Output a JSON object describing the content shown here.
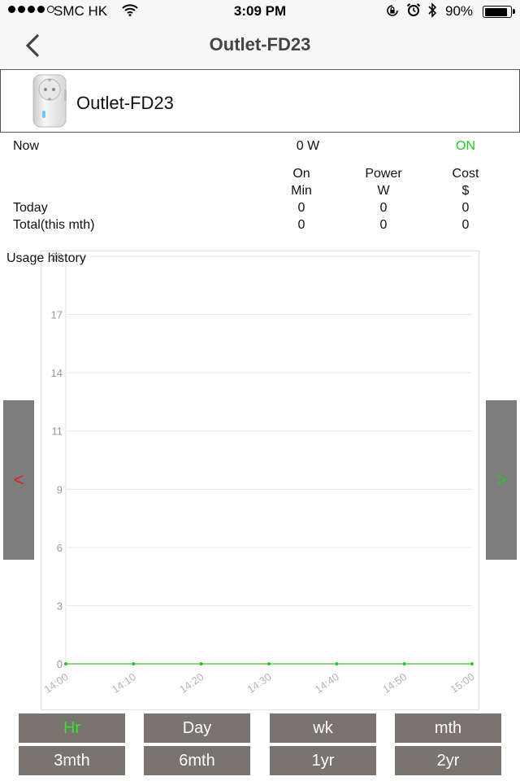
{
  "status_bar": {
    "carrier": "SMC HK",
    "time": "3:09 PM",
    "battery": "90%",
    "battery_level": 0.9,
    "signal_bars": 4,
    "icons": [
      "signal-dots-icon",
      "wifi-icon",
      "orientation-lock-icon",
      "alarm-icon",
      "bluetooth-icon",
      "battery-icon"
    ]
  },
  "nav": {
    "title": "Outlet-FD23",
    "back_icon": "chevron-left-icon"
  },
  "device": {
    "name": "Outlet-FD23",
    "image_icon": "smart-plug-icon"
  },
  "now": {
    "label": "Now",
    "power": "0 W",
    "state": "ON",
    "state_color": "#24c81f"
  },
  "stats": {
    "headers": [
      {
        "top": "On",
        "bottom": "Min"
      },
      {
        "top": "Power",
        "bottom": "W"
      },
      {
        "top": "Cost",
        "bottom": "$"
      }
    ],
    "rows": [
      {
        "label": "Today",
        "values": [
          "0",
          "0",
          "0"
        ]
      },
      {
        "label": "Total(this mth)",
        "values": [
          "0",
          "0",
          "0"
        ]
      }
    ]
  },
  "chart_label": "Usage history",
  "chart_data": {
    "type": "line",
    "title": "Usage history",
    "xlabel": "",
    "ylabel": "",
    "x": [
      "14:00",
      "14:10",
      "14:20",
      "14:30",
      "14:40",
      "14:50",
      "15:00"
    ],
    "y_ticks": [
      "0",
      "3",
      "6",
      "9",
      "11",
      "14",
      "17",
      "20"
    ],
    "ylim": [
      0,
      20
    ],
    "series": [
      {
        "color": "#24c81f",
        "values": [
          0,
          0,
          0,
          0,
          0,
          0,
          0
        ]
      }
    ],
    "grid": true,
    "baseline_color": "#f08080"
  },
  "nav_arrows": {
    "prev": "<",
    "next": ">",
    "prev_color": "#e01f1f",
    "next_color": "#24c81f"
  },
  "ranges": [
    {
      "label": "Hr",
      "active": true
    },
    {
      "label": "Day",
      "active": false
    },
    {
      "label": "wk",
      "active": false
    },
    {
      "label": "mth",
      "active": false
    },
    {
      "label": "3mth",
      "active": false
    },
    {
      "label": "6mth",
      "active": false
    },
    {
      "label": "1yr",
      "active": false
    },
    {
      "label": "2yr",
      "active": false
    }
  ]
}
